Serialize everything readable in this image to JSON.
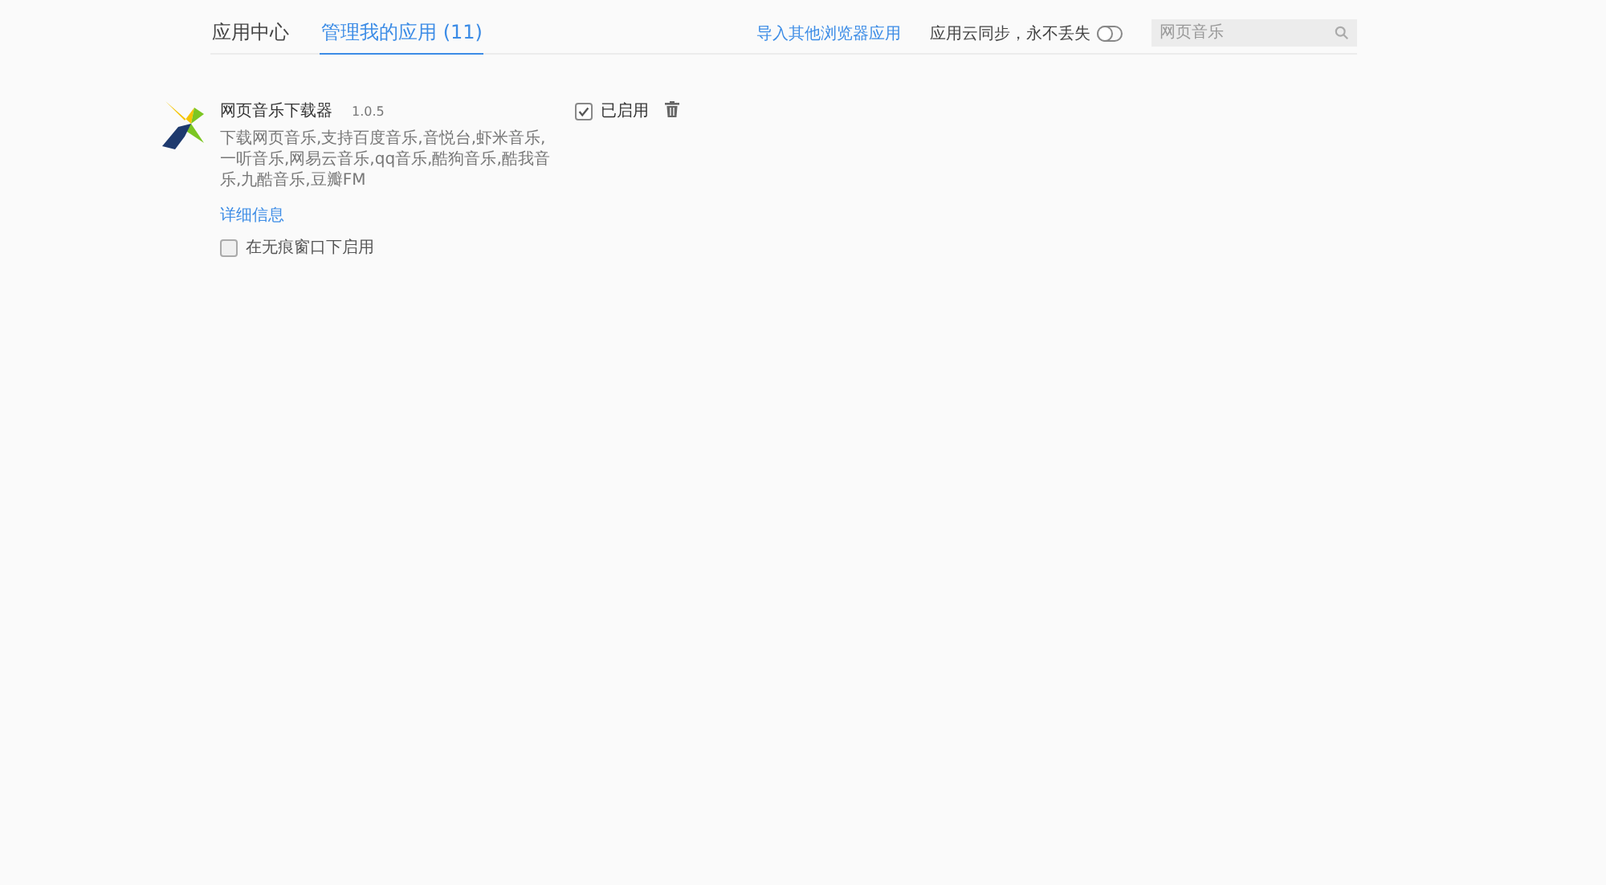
{
  "tabs": [
    {
      "label": "应用中心",
      "selected": false
    },
    {
      "label": "管理我的应用 (11)",
      "selected": true
    }
  ],
  "import_link": "导入其他浏览器应用",
  "sync": {
    "label": "应用云同步，永不丢失",
    "on": false
  },
  "search": {
    "placeholder": "网页音乐"
  },
  "apps": [
    {
      "name": "网页音乐下载器",
      "version": "1.0.5",
      "description": "下载网页音乐,支持百度音乐,音悦台,虾米音乐,一听音乐,网易云音乐,qq音乐,酷狗音乐,酷我音乐,九酷音乐,豆瓣FM",
      "details_link": "详细信息",
      "incognito": {
        "label": "在无痕窗口下启用",
        "checked": false
      },
      "enabled": {
        "label": "已启用",
        "checked": true
      }
    }
  ]
}
